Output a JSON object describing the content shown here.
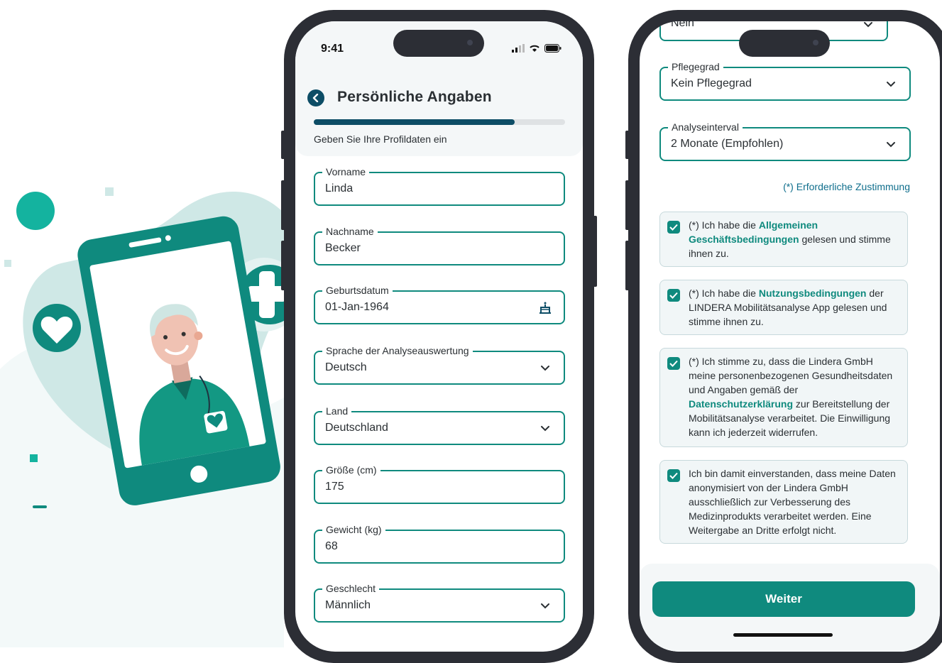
{
  "colors": {
    "accent": "#0f8a7e",
    "dark_accent": "#0d4d66",
    "illustration_bg": "#cfe8e6"
  },
  "left_phone": {
    "status_time": "9:41",
    "title": "Persönliche Angaben",
    "progress": 0.8,
    "subtitle": "Geben Sie Ihre Profildaten ein",
    "fields": [
      {
        "label": "Vorname",
        "value": "Linda",
        "icon": ""
      },
      {
        "label": "Nachname",
        "value": "Becker",
        "icon": ""
      },
      {
        "label": "Geburtsdatum",
        "value": "01-Jan-1964",
        "icon": "birthday-cake-icon"
      },
      {
        "label": "Sprache der Analyseauswertung",
        "value": "Deutsch",
        "icon": "chevron-down-icon"
      },
      {
        "label": "Land",
        "value": "Deutschland",
        "icon": "chevron-down-icon"
      },
      {
        "label": "Größe (cm)",
        "value": "175",
        "icon": ""
      },
      {
        "label": "Gewicht (kg)",
        "value": "68",
        "icon": ""
      },
      {
        "label": "Geschlecht",
        "value": "Männlich",
        "icon": "chevron-down-icon"
      }
    ]
  },
  "right_phone": {
    "partial_field_value": "Nein",
    "fields": [
      {
        "label": "Pflegegrad",
        "value": "Kein Pflegegrad",
        "icon": "chevron-down-icon"
      },
      {
        "label": "Analyseinterval",
        "value": "2 Monate (Empfohlen)",
        "icon": "chevron-down-icon"
      }
    ],
    "required_note": "(*) Erforderliche Zustimmung",
    "consents": [
      {
        "before": "(*) Ich habe die ",
        "link": "Allgemeinen Geschäftsbedingungen",
        "after": " gelesen und stimme ihnen zu.",
        "checked": true
      },
      {
        "before": "(*) Ich habe die ",
        "link": "Nutzungsbedingungen",
        "after": " der LINDERA Mobilitätsanalyse App gelesen und stimme ihnen zu.",
        "checked": true
      },
      {
        "before": "(*) Ich stimme zu, dass die Lindera GmbH meine personenbezogenen Gesundheitsdaten und Angaben gemäß der ",
        "link": "Datenschutzerklärung",
        "after": " zur Bereitstellung der Mobilitätsanalyse verarbeitet. Die Einwilligung kann ich jederzeit widerrufen.",
        "checked": true
      },
      {
        "before": "Ich bin damit einverstanden, dass meine Daten anonymisiert von der Lindera GmbH ausschließlich zur Verbesserung des Medizinprodukts verarbeitet werden. Eine Weitergabe an Dritte erfolgt nicht.",
        "link": "",
        "after": "",
        "checked": true
      }
    ],
    "continue_label": "Weiter"
  }
}
